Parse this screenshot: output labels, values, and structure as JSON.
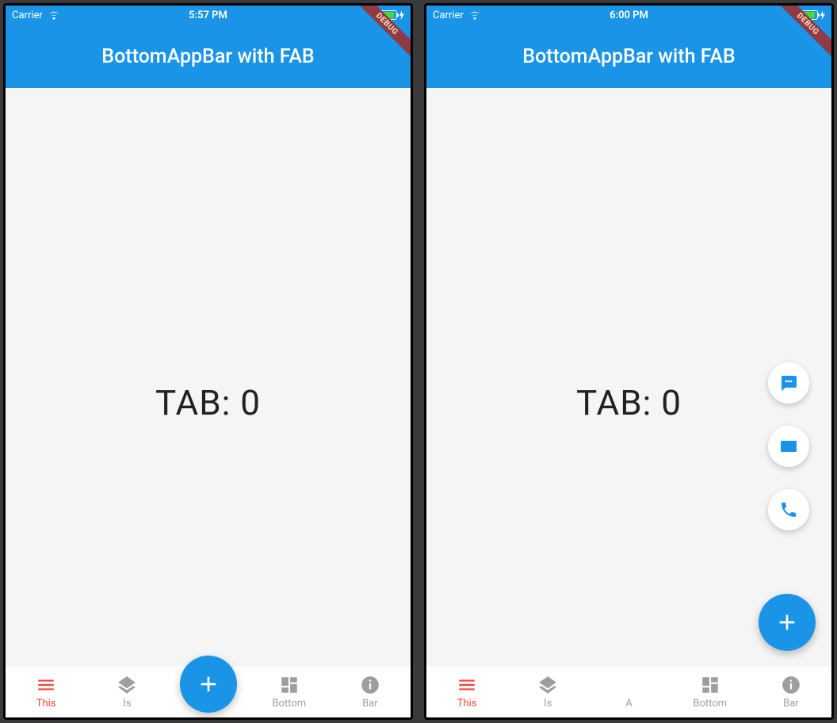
{
  "status": {
    "carrier": "Carrier",
    "time_left": "5:57 PM",
    "time_right": "6:00 PM"
  },
  "app_bar": {
    "title": "BottomAppBar with FAB"
  },
  "debug_banner": "DEBUG",
  "body": {
    "tab_text": "TAB: 0"
  },
  "nav_left": {
    "items": [
      {
        "label": "This",
        "icon": "menu",
        "active": true
      },
      {
        "label": "Is",
        "icon": "layers",
        "active": false
      },
      {
        "label": "",
        "icon": "",
        "spacer": true
      },
      {
        "label": "Bottom",
        "icon": "dashboard",
        "active": false
      },
      {
        "label": "Bar",
        "icon": "info",
        "active": false
      }
    ]
  },
  "nav_right": {
    "items": [
      {
        "label": "This",
        "icon": "menu",
        "active": true
      },
      {
        "label": "Is",
        "icon": "layers",
        "active": false
      },
      {
        "label": "A",
        "icon": "",
        "active": false
      },
      {
        "label": "Bottom",
        "icon": "dashboard",
        "active": false
      },
      {
        "label": "Bar",
        "icon": "info",
        "active": false
      }
    ]
  },
  "fab": {
    "icon": "add"
  },
  "speed_dial": [
    {
      "icon": "sms"
    },
    {
      "icon": "mail"
    },
    {
      "icon": "phone"
    }
  ]
}
